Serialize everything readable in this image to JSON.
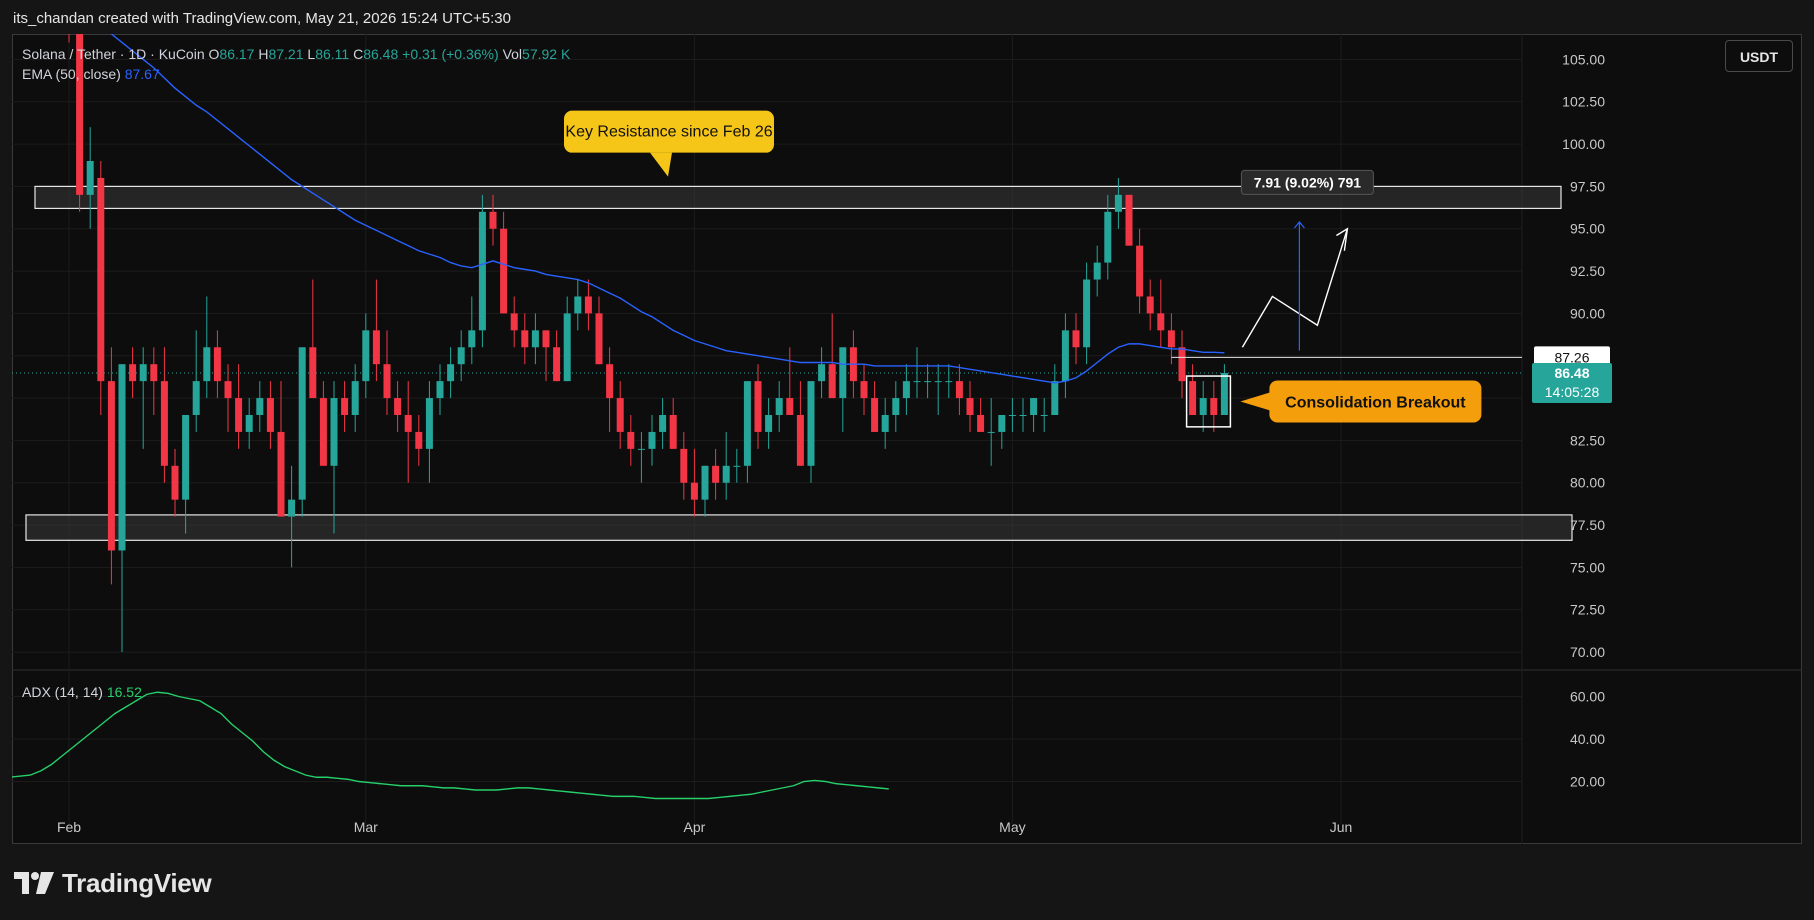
{
  "header": {
    "attribution": "its_chandan created with TradingView.com, May 21, 2026 15:24 UTC+5:30"
  },
  "legend": {
    "symbol": "Solana / Tether · 1D · KuCoin",
    "o_label": "O",
    "o_value": "86.17",
    "h_label": "H",
    "h_value": "87.21",
    "l_label": "L",
    "l_value": "86.11",
    "c_label": "C",
    "c_value": "86.48",
    "change": "+0.31 (+0.36%)",
    "vol_label": "Vol",
    "vol_value": "57.92 K",
    "ema_label": "EMA (50, close)",
    "ema_value": "87.67",
    "adx_label": "ADX (14, 14)",
    "adx_value": "16.52"
  },
  "currency_button": "USDT",
  "brand": {
    "name": "TradingView",
    "logo_icon": "tradingview-logo-icon"
  },
  "colors": {
    "up": "#26a69a",
    "down": "#f23645",
    "ema": "#2962ff",
    "adx": "#26d06a",
    "callout_yellow": "#f5c518",
    "callout_orange": "#f59e0b"
  },
  "chart_data": {
    "type": "candlestick",
    "x_axis": {
      "ticks": [
        "Feb",
        "Mar",
        "Apr",
        "May",
        "Jun"
      ]
    },
    "price_axis": {
      "ticks": [
        "105.00",
        "102.50",
        "100.00",
        "97.50",
        "95.00",
        "92.50",
        "90.00",
        "87.50",
        "85.00",
        "82.50",
        "80.00",
        "77.50",
        "75.00",
        "72.50",
        "70.00"
      ],
      "ylim": [
        69.0,
        106.5
      ]
    },
    "adx_axis": {
      "ticks": [
        "60.00",
        "40.00",
        "20.00"
      ],
      "ylim": [
        0,
        72
      ]
    },
    "price_labels": {
      "ema": "87.26",
      "last": "86.48",
      "countdown": "14:05:28"
    },
    "candles": [
      [
        113,
        114,
        106,
        108
      ],
      [
        108,
        110,
        96,
        97
      ],
      [
        97,
        101,
        95,
        99
      ],
      [
        98,
        99,
        84,
        86
      ],
      [
        86,
        88,
        74,
        76
      ],
      [
        76,
        87,
        70,
        87
      ],
      [
        87,
        88,
        85,
        86
      ],
      [
        86,
        88,
        82,
        87
      ],
      [
        87,
        88,
        84,
        86
      ],
      [
        86,
        88,
        80,
        81
      ],
      [
        81,
        82,
        78,
        79
      ],
      [
        79,
        84,
        77,
        84
      ],
      [
        84,
        89,
        83,
        86
      ],
      [
        86,
        91,
        85,
        88
      ],
      [
        88,
        89,
        85,
        86
      ],
      [
        86,
        87,
        83,
        85
      ],
      [
        85,
        87,
        82,
        83
      ],
      [
        83,
        85,
        82,
        84
      ],
      [
        84,
        86,
        83,
        85
      ],
      [
        85,
        86,
        82,
        83
      ],
      [
        83,
        86,
        78,
        78
      ],
      [
        78,
        81,
        75,
        79
      ],
      [
        79,
        88,
        78,
        88
      ],
      [
        88,
        92,
        87,
        85
      ],
      [
        85,
        86,
        82,
        81
      ],
      [
        81,
        86,
        77,
        85
      ],
      [
        85,
        86,
        83,
        84
      ],
      [
        84,
        87,
        83,
        86
      ],
      [
        86,
        90,
        85,
        89
      ],
      [
        89,
        92,
        86,
        87
      ],
      [
        87,
        89,
        84,
        85
      ],
      [
        85,
        86,
        83,
        84
      ],
      [
        84,
        86,
        80,
        83
      ],
      [
        83,
        84,
        81,
        82
      ],
      [
        82,
        86,
        80,
        85
      ],
      [
        85,
        87,
        84,
        86
      ],
      [
        86,
        88,
        85,
        87
      ],
      [
        87,
        89,
        86,
        88
      ],
      [
        88,
        91,
        87,
        89
      ],
      [
        89,
        97,
        88,
        96
      ],
      [
        96,
        97,
        94,
        95
      ],
      [
        95,
        96,
        90,
        90
      ],
      [
        90,
        91,
        88,
        89
      ],
      [
        89,
        90,
        87,
        88
      ],
      [
        88,
        90,
        87,
        89
      ],
      [
        89,
        89,
        86,
        88
      ],
      [
        88,
        89,
        86,
        86
      ],
      [
        86,
        91,
        86,
        90
      ],
      [
        90,
        92,
        89,
        91
      ],
      [
        91,
        92,
        89,
        90
      ],
      [
        90,
        91,
        87,
        87
      ],
      [
        87,
        88,
        83,
        85
      ],
      [
        85,
        86,
        82,
        83
      ],
      [
        83,
        84,
        81,
        82
      ],
      [
        82,
        83,
        80,
        82
      ],
      [
        82,
        84,
        81,
        83
      ],
      [
        83,
        85,
        82,
        84
      ],
      [
        84,
        85,
        82,
        82
      ],
      [
        82,
        83,
        79,
        80
      ],
      [
        80,
        82,
        78,
        79
      ],
      [
        79,
        81,
        78,
        81
      ],
      [
        81,
        82,
        79,
        80
      ],
      [
        80,
        83,
        79,
        81
      ],
      [
        81,
        82,
        80,
        81
      ],
      [
        81,
        86,
        80,
        86
      ],
      [
        86,
        87,
        82,
        83
      ],
      [
        83,
        85,
        82,
        84
      ],
      [
        84,
        86,
        83,
        85
      ],
      [
        85,
        88,
        84,
        84
      ],
      [
        84,
        86,
        81,
        81
      ],
      [
        81,
        86,
        80,
        86
      ],
      [
        86,
        88,
        85,
        87
      ],
      [
        87,
        90,
        85,
        85
      ],
      [
        85,
        88,
        83,
        88
      ],
      [
        88,
        89,
        85,
        86
      ],
      [
        86,
        87,
        84,
        85
      ],
      [
        85,
        86,
        83,
        83
      ],
      [
        83,
        85,
        82,
        84
      ],
      [
        84,
        86,
        83,
        85
      ],
      [
        85,
        87,
        84,
        86
      ],
      [
        86,
        88,
        85,
        86
      ],
      [
        86,
        87,
        85,
        86
      ],
      [
        86,
        87,
        84,
        86
      ],
      [
        86,
        87,
        85,
        86
      ],
      [
        86,
        87,
        84,
        85
      ],
      [
        85,
        86,
        83,
        84
      ],
      [
        84,
        85,
        83,
        83
      ],
      [
        83,
        85,
        81,
        83
      ],
      [
        83,
        84,
        82,
        84
      ],
      [
        84,
        85,
        83,
        84
      ],
      [
        84,
        85,
        83,
        84
      ],
      [
        84,
        85,
        83,
        85
      ],
      [
        84,
        85,
        83,
        84
      ],
      [
        84,
        87,
        84,
        86
      ],
      [
        86,
        90,
        85,
        89
      ],
      [
        89,
        90,
        87,
        88
      ],
      [
        88,
        93,
        87,
        92
      ],
      [
        92,
        94,
        91,
        93
      ],
      [
        93,
        97,
        92,
        96
      ],
      [
        96,
        98,
        95,
        97
      ],
      [
        97,
        97,
        94,
        94
      ],
      [
        94,
        95,
        90,
        91
      ],
      [
        91,
        92,
        89,
        90
      ],
      [
        90,
        92,
        88,
        89
      ],
      [
        89,
        90,
        87,
        88
      ],
      [
        88,
        89,
        85,
        86
      ],
      [
        86,
        87,
        84,
        84
      ],
      [
        84,
        86,
        83,
        85
      ],
      [
        85,
        86,
        83,
        84
      ],
      [
        84,
        87,
        84,
        86.48
      ]
    ],
    "ema": [
      108.5,
      107.9,
      107.4,
      106.9,
      106.5,
      106.0,
      105.5,
      105.0,
      104.5,
      103.9,
      103.3,
      102.8,
      102.3,
      101.9,
      101.4,
      100.9,
      100.4,
      99.9,
      99.4,
      98.9,
      98.4,
      97.9,
      97.5,
      97.1,
      96.7,
      96.3,
      95.9,
      95.5,
      95.2,
      94.9,
      94.6,
      94.3,
      94.0,
      93.7,
      93.5,
      93.3,
      93.0,
      92.8,
      92.7,
      92.9,
      93.1,
      92.9,
      92.7,
      92.6,
      92.5,
      92.3,
      92.2,
      92.1,
      92.0,
      91.8,
      91.5,
      91.2,
      90.9,
      90.5,
      90.1,
      89.8,
      89.4,
      89.0,
      88.7,
      88.4,
      88.2,
      88.0,
      87.8,
      87.7,
      87.6,
      87.5,
      87.4,
      87.3,
      87.2,
      87.1,
      87.1,
      87.1,
      87.1,
      87.0,
      87.0,
      87.0,
      86.9,
      86.9,
      86.9,
      86.9,
      86.9,
      86.9,
      86.9,
      86.9,
      86.8,
      86.7,
      86.6,
      86.5,
      86.4,
      86.3,
      86.2,
      86.1,
      86.0,
      85.9,
      86.0,
      86.2,
      86.6,
      87.1,
      87.6,
      88.0,
      88.2,
      88.2,
      88.1,
      88.0,
      87.9,
      87.9,
      87.8,
      87.7,
      87.7,
      87.67
    ],
    "adx": [
      22,
      22.5,
      23,
      25,
      28,
      32,
      36,
      40,
      44,
      48,
      52,
      55,
      58,
      61,
      62,
      61.5,
      60,
      59,
      58,
      55,
      52,
      47,
      43,
      39,
      34,
      30,
      27,
      25,
      23,
      22,
      22,
      21.5,
      21,
      20,
      19.5,
      19,
      18.5,
      18,
      18,
      18,
      17.5,
      17,
      17,
      16.5,
      16,
      16,
      16,
      16.5,
      17,
      17,
      16.5,
      16,
      15.5,
      15,
      14.5,
      14,
      13.5,
      13,
      13,
      13,
      12.5,
      12,
      12,
      12,
      12,
      12,
      12,
      12.5,
      13,
      13.5,
      14,
      15,
      16,
      17,
      18,
      20,
      20.5,
      20,
      19,
      18.5,
      18,
      17.5,
      17,
      16.52
    ],
    "annotations": {
      "resistance_label": "Key Resistance since Feb 26",
      "breakout_label": "Consolidation Breakout",
      "measure_label": "7.91 (9.02%) 791"
    }
  }
}
